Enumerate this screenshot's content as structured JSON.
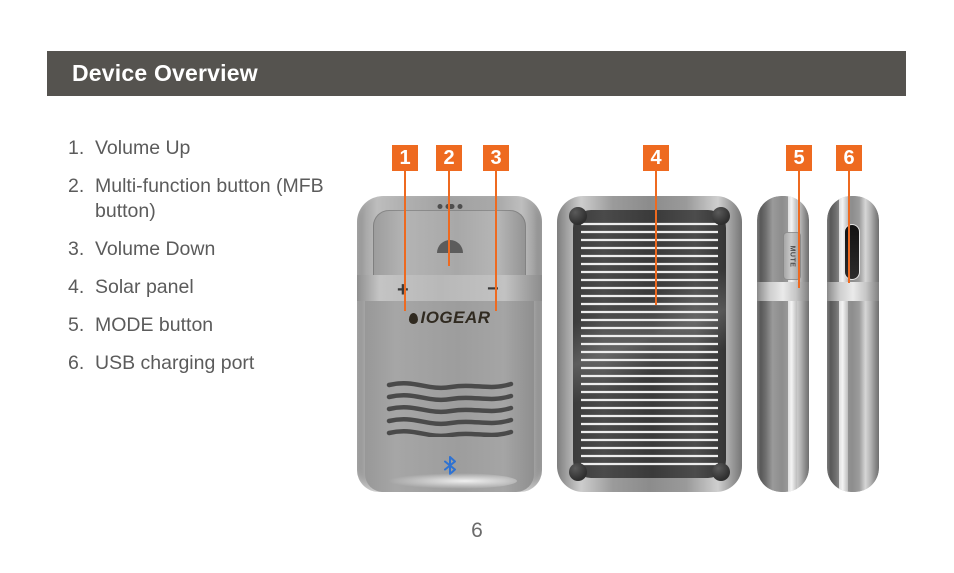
{
  "header": {
    "title": "Device Overview",
    "background_color": "#55534F",
    "text_color": "#FFFFFF"
  },
  "legend": {
    "items": [
      {
        "num": "1.",
        "label": "Volume Up"
      },
      {
        "num": "2.",
        "label": "Multi-function button (MFB button)"
      },
      {
        "num": "3.",
        "label": "Volume Down"
      },
      {
        "num": "4.",
        "label": "Solar panel"
      },
      {
        "num": "5.",
        "label": "MODE button"
      },
      {
        "num": "6.",
        "label": "USB charging port"
      }
    ],
    "text_color": "#5B5B5B"
  },
  "callouts": {
    "accent_color": "#EE6A20",
    "items": [
      {
        "number": "1",
        "target": "volume-up-button"
      },
      {
        "number": "2",
        "target": "multi-function-button"
      },
      {
        "number": "3",
        "target": "volume-down-button"
      },
      {
        "number": "4",
        "target": "solar-panel"
      },
      {
        "number": "5",
        "target": "mode-button"
      },
      {
        "number": "6",
        "target": "usb-charging-port"
      }
    ]
  },
  "device": {
    "brand_logo_text": "IOGEAR",
    "front": {
      "volume_up_symbol": "+",
      "volume_down_symbol": "−",
      "bluetooth_icon": "bluetooth-icon",
      "bluetooth_color": "#2E72D2",
      "led_dot_count": 4,
      "speaker_grille_lines": 5
    },
    "side_left": {
      "mode_button_label": "MUTE"
    },
    "side_right": {
      "port_label": "usb-port"
    },
    "solar_panel": {
      "cell_line_count": 30
    }
  },
  "footer": {
    "page_number": "6"
  }
}
